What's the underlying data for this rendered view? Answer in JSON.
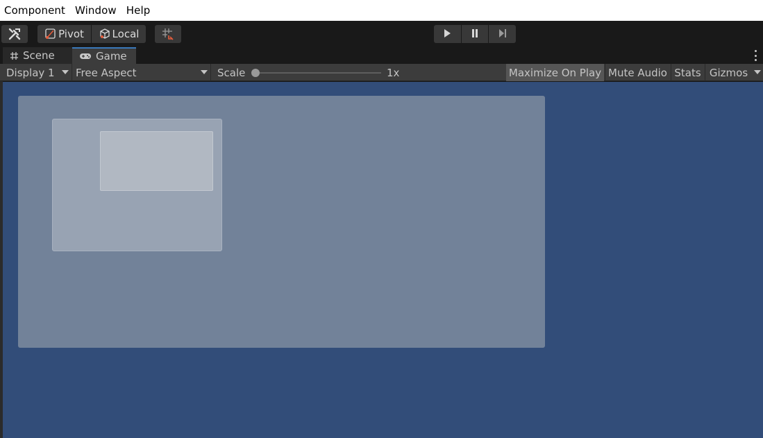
{
  "menubar": {
    "items": [
      "Component",
      "Window",
      "Help"
    ]
  },
  "toolbar": {
    "tools_icon": "tools-icon",
    "pivot_label": "Pivot",
    "local_label": "Local",
    "grid_icon": "grid-snap-icon",
    "play_icon": "play-icon",
    "pause_icon": "pause-icon",
    "step_icon": "step-icon"
  },
  "tabs": {
    "scene": {
      "label": "Scene",
      "icon": "grid-hash-icon"
    },
    "game": {
      "label": "Game",
      "icon": "gamepad-icon"
    }
  },
  "gamebar": {
    "display": "Display 1",
    "aspect": "Free Aspect",
    "scale_label": "Scale",
    "scale_value": "1x",
    "scale_level": 0,
    "maximize": "Maximize On Play",
    "mute": "Mute Audio",
    "stats": "Stats",
    "gizmos": "Gizmos"
  },
  "colors": {
    "game_background": "#324d79",
    "panel_outer": "#728299",
    "panel_mid": "#98a3b3",
    "panel_inner": "#b1b8c2",
    "tab_accent": "#3a79bb"
  }
}
